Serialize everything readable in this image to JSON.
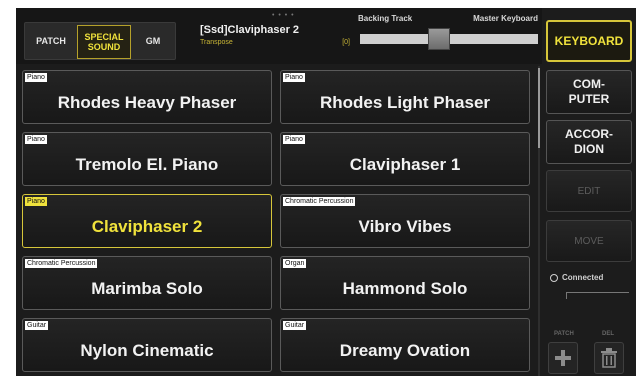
{
  "tabs": [
    {
      "label": "PATCH"
    },
    {
      "label": "SPECIAL SOUND"
    },
    {
      "label": "GM"
    }
  ],
  "current_patch": {
    "dots": "• • • •",
    "name": "[Ssd]Claviphaser 2",
    "transpose_label": "Transpose",
    "transpose_value": "[0]"
  },
  "balance_slider": {
    "left_label": "Backing Track",
    "right_label": "Master Keyboard"
  },
  "patches": [
    {
      "category": "Piano",
      "name": "Rhodes Heavy Phaser"
    },
    {
      "category": "Piano",
      "name": "Rhodes Light Phaser"
    },
    {
      "category": "Piano",
      "name": "Tremolo El. Piano"
    },
    {
      "category": "Piano",
      "name": "Claviphaser 1"
    },
    {
      "category": "Piano",
      "name": "Claviphaser 2"
    },
    {
      "category": "Chromatic Percussion",
      "name": "Vibro Vibes"
    },
    {
      "category": "Chromatic Percussion",
      "name": "Marimba Solo"
    },
    {
      "category": "Organ",
      "name": "Hammond Solo"
    },
    {
      "category": "Guitar",
      "name": "Nylon Cinematic"
    },
    {
      "category": "Guitar",
      "name": "Dreamy Ovation"
    }
  ],
  "side": {
    "keyboard": "KEYBOARD",
    "computer": "COM-\nPUTER",
    "accordion": "ACCOR-\nDION",
    "edit": "EDIT",
    "move": "MOVE",
    "connected": "Connected",
    "patch_label": "PATCH",
    "del_label": "DEL"
  },
  "colors": {
    "accent": "#f0e23c",
    "background": "#1c1c1c",
    "button_border": "#5a5a5a"
  },
  "icons": {
    "add": "plus-icon",
    "delete": "trash-icon"
  }
}
